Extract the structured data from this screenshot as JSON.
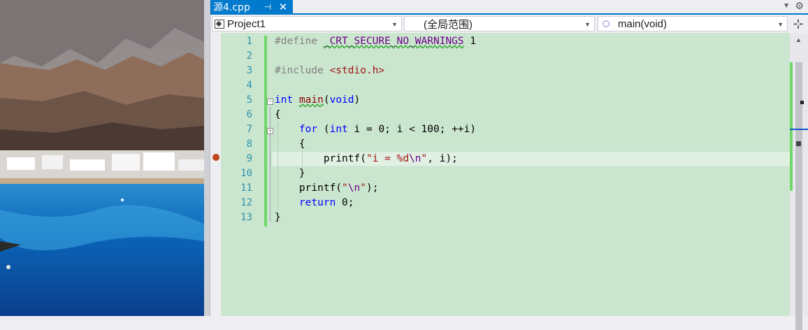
{
  "tab": {
    "title": "源4.cpp",
    "pin_icon": "pin-icon",
    "close_icon": "close-icon"
  },
  "nav": {
    "project": "Project1",
    "scope": "(全局范围)",
    "function": "main(void)"
  },
  "line_numbers": [
    "1",
    "2",
    "3",
    "4",
    "5",
    "6",
    "7",
    "8",
    "9",
    "10",
    "11",
    "12",
    "13"
  ],
  "code": {
    "l1_directive": "#define",
    "l1_macro": "_CRT_SECURE_NO_WARNINGS",
    "l1_value": "1",
    "l3_directive": "#include",
    "l3_header": "<stdio.h>",
    "l5_type": "int",
    "l5_name": "main",
    "l5_params_open": "(",
    "l5_void": "void",
    "l5_params_close": ")",
    "l6": "{",
    "l7_for": "for",
    "l7_paren": " (",
    "l7_int": "int",
    "l7_rest": " i = 0; i < 100; ++i)",
    "l8": "{",
    "l9_fn": "printf(",
    "l9_str_a": "\"i = %d",
    "l9_esc": "\\n",
    "l9_str_b": "\"",
    "l9_rest": ", i);",
    "l10": "}",
    "l11_fn": "printf(",
    "l11_str_a": "\"",
    "l11_esc": "\\n",
    "l11_str_b": "\"",
    "l11_rest": ");",
    "l12_kw": "return",
    "l12_rest": " 0;",
    "l13": "}"
  },
  "colors": {
    "editor_background": "#cbe6cf",
    "tab_active": "#007acc",
    "keyword": "#0000ff",
    "string": "#a31515",
    "line_number": "#2b91af",
    "breakpoint": "#c0451c",
    "change_bar": "#6fd86a"
  },
  "breakpoint_line": 9
}
